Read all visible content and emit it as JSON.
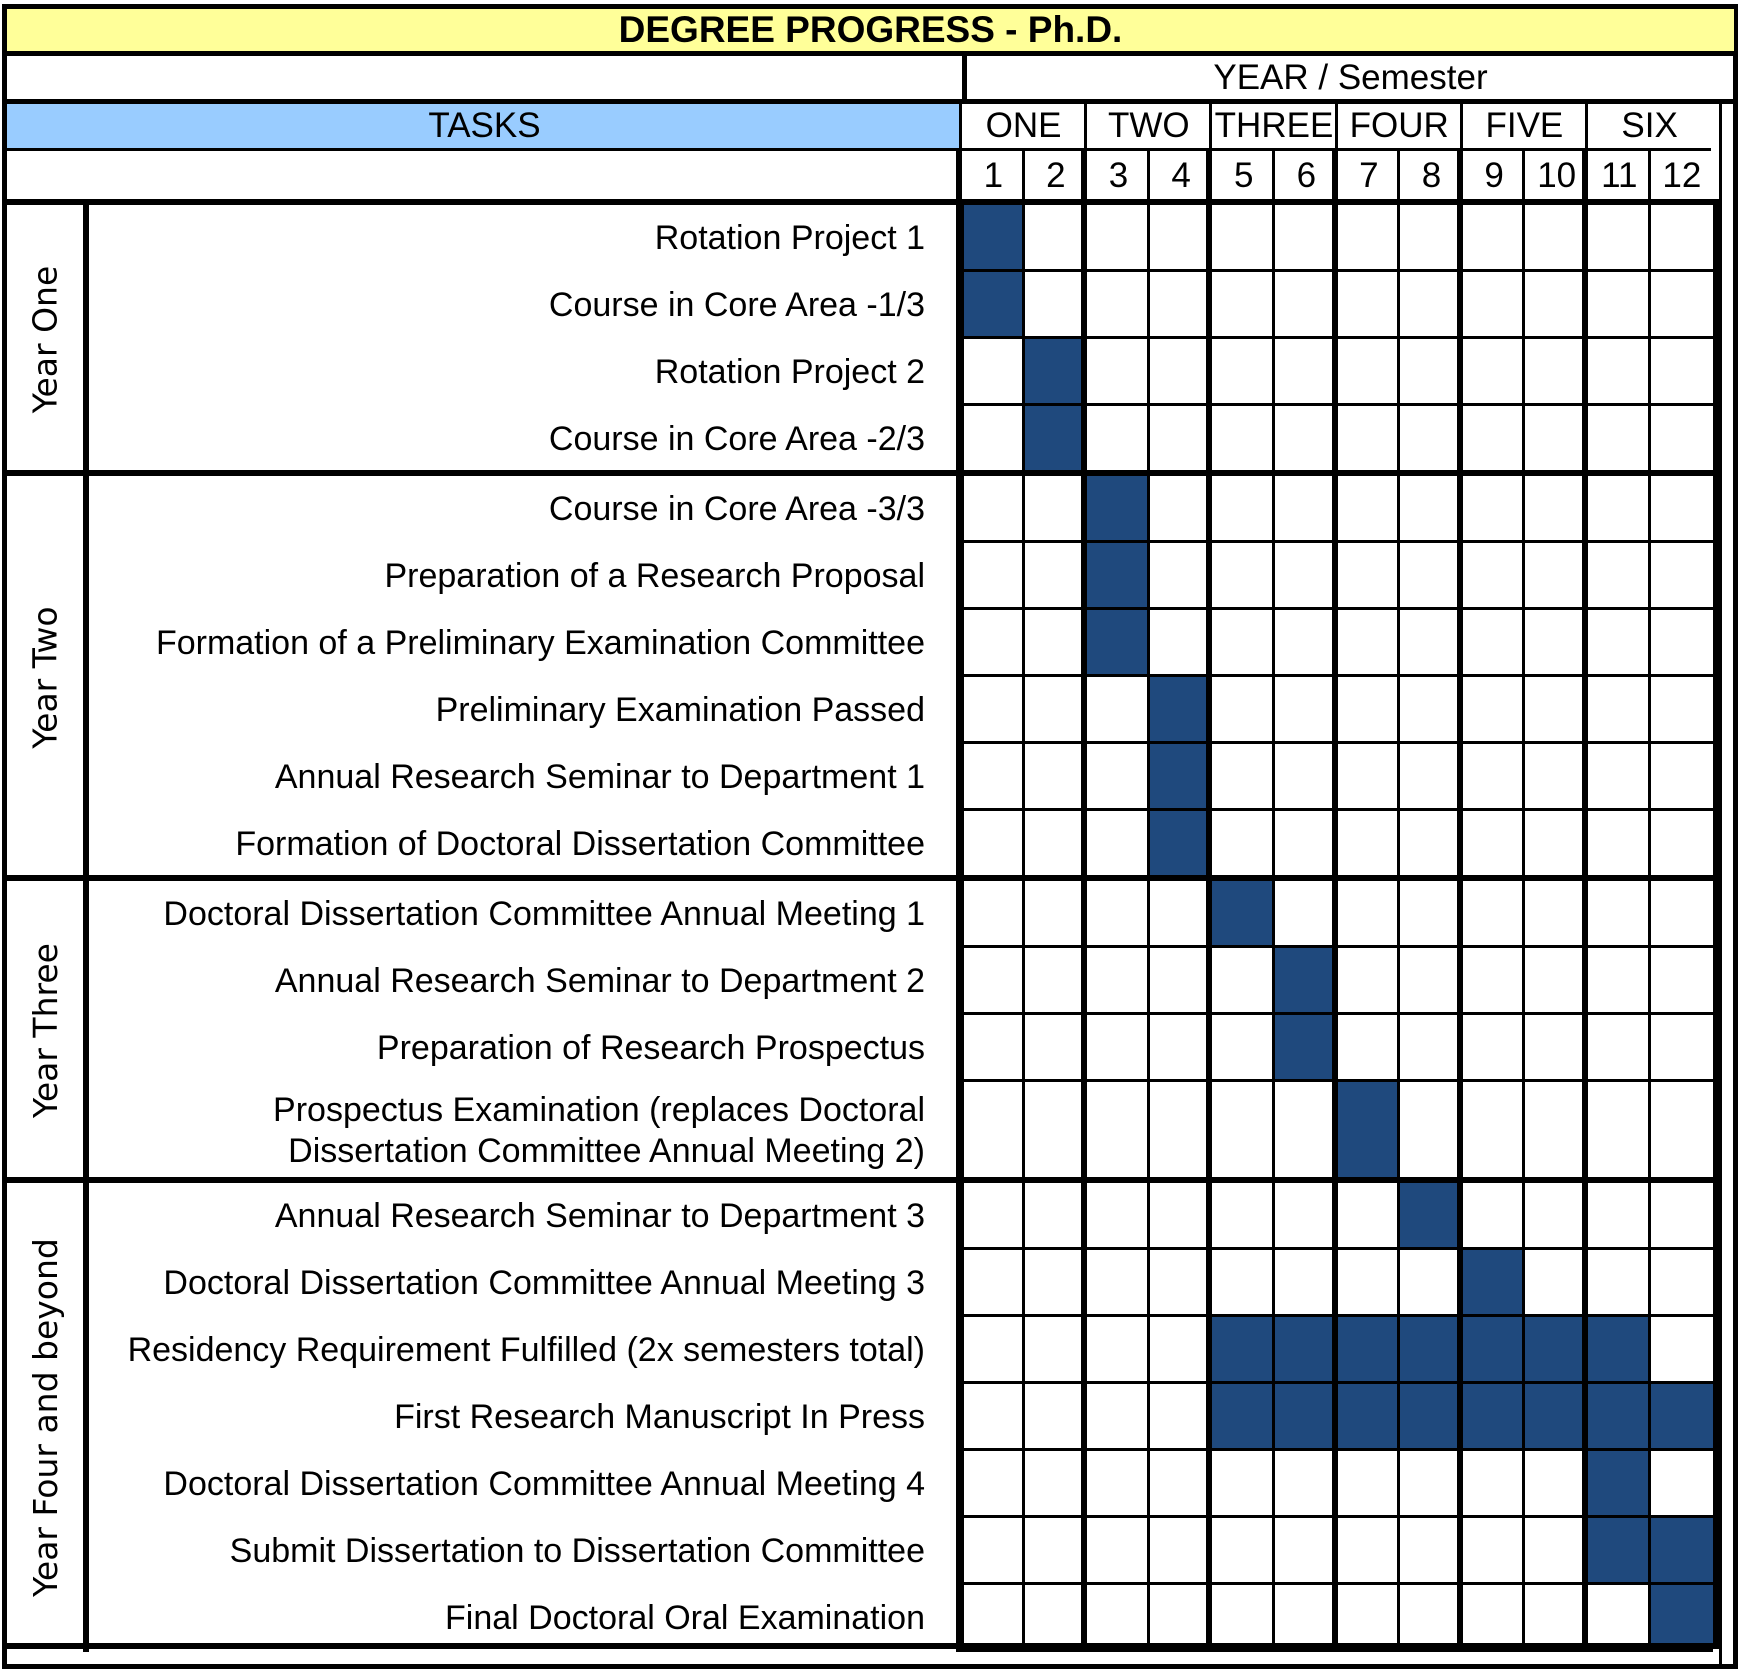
{
  "title": "DEGREE PROGRESS - Ph.D.",
  "header": {
    "year_semester_label": "YEAR / Semester",
    "tasks_label": "TASKS",
    "years": [
      "ONE",
      "TWO",
      "THREE",
      "FOUR",
      "FIVE",
      "SIX"
    ],
    "semesters": [
      "1",
      "2",
      "3",
      "4",
      "5",
      "6",
      "7",
      "8",
      "9",
      "10",
      "11",
      "12"
    ]
  },
  "colors": {
    "title_bg": "#ffff99",
    "tasks_bg": "#99ccff",
    "fill": "#1f497d"
  },
  "sections": [
    {
      "label": "Year One",
      "tasks": [
        {
          "name": "Rotation Project 1",
          "semesters": [
            1
          ]
        },
        {
          "name": "Course in Core Area -1/3",
          "semesters": [
            1
          ]
        },
        {
          "name": "Rotation Project 2",
          "semesters": [
            2
          ]
        },
        {
          "name": "Course in Core Area -2/3",
          "semesters": [
            2
          ]
        }
      ]
    },
    {
      "label": "Year Two",
      "tasks": [
        {
          "name": "Course in Core Area -3/3",
          "semesters": [
            3
          ]
        },
        {
          "name": "Preparation of a Research Proposal",
          "semesters": [
            3
          ]
        },
        {
          "name": "Formation of a Preliminary Examination Committee",
          "semesters": [
            3
          ]
        },
        {
          "name": "Preliminary Examination Passed",
          "semesters": [
            4
          ]
        },
        {
          "name": "Annual Research Seminar to Department 1",
          "semesters": [
            4
          ]
        },
        {
          "name": "Formation of Doctoral Dissertation Committee",
          "semesters": [
            4
          ]
        }
      ]
    },
    {
      "label": "Year Three",
      "tasks": [
        {
          "name": "Doctoral Dissertation Committee Annual Meeting 1",
          "semesters": [
            5
          ]
        },
        {
          "name": "Annual Research Seminar to Department 2",
          "semesters": [
            6
          ]
        },
        {
          "name": "Preparation of Research Prospectus",
          "semesters": [
            6
          ]
        },
        {
          "name": "Prospectus Examination (replaces Doctoral Dissertation Committee Annual Meeting 2)",
          "semesters": [
            7
          ]
        }
      ]
    },
    {
      "label": "Year Four and beyond",
      "tasks": [
        {
          "name": "Annual Research Seminar to Department 3",
          "semesters": [
            8
          ]
        },
        {
          "name": "Doctoral Dissertation Committee Annual Meeting 3",
          "semesters": [
            9
          ]
        },
        {
          "name": "Residency Requirement Fulfilled (2x semesters total)",
          "semesters": [
            5,
            6,
            7,
            8,
            9,
            10,
            11
          ]
        },
        {
          "name": "First Research Manuscript In Press",
          "semesters": [
            5,
            6,
            7,
            8,
            9,
            10,
            11,
            12
          ]
        },
        {
          "name": "Doctoral Dissertation Committee Annual Meeting 4",
          "semesters": [
            11
          ]
        },
        {
          "name": "Submit Dissertation to Dissertation Committee",
          "semesters": [
            11,
            12
          ]
        },
        {
          "name": "Final Doctoral Oral Examination",
          "semesters": [
            12
          ]
        }
      ]
    }
  ]
}
